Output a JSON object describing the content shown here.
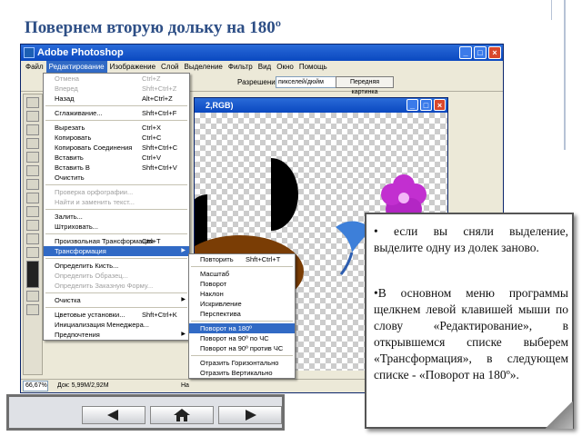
{
  "slide": {
    "title": "Повернем вторую дольку на 180º"
  },
  "app": {
    "title": "Adobe Photoshop",
    "menubar": [
      "Файл",
      "Редактирование",
      "Изображение",
      "Слой",
      "Выделение",
      "Фильтр",
      "Вид",
      "Окно",
      "Помощь"
    ],
    "options": {
      "resolution_label": "Разрешение:",
      "resolution_value": "пикселей/дюйм",
      "front_image_button": "Передняя картинка"
    },
    "document_title": "2,RGB)",
    "status": {
      "zoom": "66,67%",
      "doc_info": "Док: 5,99M/2,92M",
      "hint": "На"
    }
  },
  "edit_menu": {
    "items": [
      {
        "label": "Отмена",
        "shortcut": "Ctrl+Z",
        "state": "disabled"
      },
      {
        "label": "Вперед",
        "shortcut": "Shft+Ctrl+Z",
        "state": "disabled"
      },
      {
        "label": "Назад",
        "shortcut": "Alt+Ctrl+Z",
        "state": "normal"
      },
      {
        "sep": true
      },
      {
        "label": "Сглаживание...",
        "shortcut": "Shft+Ctrl+F",
        "state": "normal"
      },
      {
        "sep": true
      },
      {
        "label": "Вырезать",
        "shortcut": "Ctrl+X",
        "state": "normal"
      },
      {
        "label": "Копировать",
        "shortcut": "Ctrl+C",
        "state": "normal"
      },
      {
        "label": "Копировать Соединения",
        "shortcut": "Shft+Ctrl+C",
        "state": "normal"
      },
      {
        "label": "Вставить",
        "shortcut": "Ctrl+V",
        "state": "normal"
      },
      {
        "label": "Вставить В",
        "shortcut": "Shft+Ctrl+V",
        "state": "normal"
      },
      {
        "label": "Очистить",
        "shortcut": "",
        "state": "normal"
      },
      {
        "sep": true
      },
      {
        "label": "Проверка орфографии...",
        "shortcut": "",
        "state": "disabled"
      },
      {
        "label": "Найти и заменить текст...",
        "shortcut": "",
        "state": "disabled"
      },
      {
        "sep": true
      },
      {
        "label": "Залить...",
        "shortcut": "",
        "state": "normal"
      },
      {
        "label": "Штриховать...",
        "shortcut": "",
        "state": "normal"
      },
      {
        "sep": true
      },
      {
        "label": "Произвольная Трансформация",
        "shortcut": "Ctrl+T",
        "state": "normal"
      },
      {
        "label": "Трансформация",
        "shortcut": "",
        "state": "highlighted",
        "submenu": true
      },
      {
        "sep": true
      },
      {
        "label": "Определить Кисть...",
        "shortcut": "",
        "state": "normal"
      },
      {
        "label": "Определить Образец...",
        "shortcut": "",
        "state": "disabled"
      },
      {
        "label": "Определить Заказную Форму...",
        "shortcut": "",
        "state": "disabled"
      },
      {
        "sep": true
      },
      {
        "label": "Очистка",
        "shortcut": "",
        "state": "normal",
        "submenu": true
      },
      {
        "sep": true
      },
      {
        "label": "Цветовые установки...",
        "shortcut": "Shft+Ctrl+K",
        "state": "normal"
      },
      {
        "label": "Инициализация Менеджера...",
        "shortcut": "",
        "state": "normal"
      },
      {
        "label": "Предпочтения",
        "shortcut": "",
        "state": "normal",
        "submenu": true
      }
    ]
  },
  "transform_menu": {
    "items": [
      {
        "label": "Повторить",
        "shortcut": "Shft+Ctrl+T",
        "state": "normal"
      },
      {
        "sep": true
      },
      {
        "label": "Масштаб",
        "shortcut": "",
        "state": "normal"
      },
      {
        "label": "Поворот",
        "shortcut": "",
        "state": "normal"
      },
      {
        "label": "Наклон",
        "shortcut": "",
        "state": "normal"
      },
      {
        "label": "Искривление",
        "shortcut": "",
        "state": "normal"
      },
      {
        "label": "Перспектива",
        "shortcut": "",
        "state": "normal"
      },
      {
        "sep": true
      },
      {
        "label": "Поворот на 180º",
        "shortcut": "",
        "state": "highlighted"
      },
      {
        "label": "Поворот на 90º по ЧС",
        "shortcut": "",
        "state": "normal"
      },
      {
        "label": "Поворот на 90º против ЧС",
        "shortcut": "",
        "state": "normal"
      },
      {
        "sep": true
      },
      {
        "label": "Отразить Горизонтально",
        "shortcut": "",
        "state": "normal"
      },
      {
        "label": "Отразить Вертикально",
        "shortcut": "",
        "state": "normal"
      }
    ]
  },
  "callout": {
    "bullet1": "• если вы сняли выделение, выделите одну из долек заново.",
    "bullet2": "•В основном меню программы щелкнем левой клавишей мыши по слову «Редактирование», в открывшемся списке выберем «Трансформация», в следующем списке - «Поворот на 180º»."
  },
  "nav": {
    "icons": [
      "back-arrow-icon",
      "home-icon",
      "forward-arrow-icon"
    ]
  },
  "colors": {
    "title": "#2e4f86",
    "highlight": "#316ac5",
    "brown": "#7a3d05",
    "flower": "#c22fd0",
    "flower_blue": "#3d7fd9"
  }
}
